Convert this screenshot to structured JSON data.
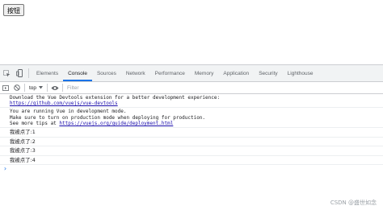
{
  "page": {
    "button_label": "按钮"
  },
  "devtools": {
    "tabs": [
      {
        "label": "Elements",
        "active": false
      },
      {
        "label": "Console",
        "active": true
      },
      {
        "label": "Sources",
        "active": false
      },
      {
        "label": "Network",
        "active": false
      },
      {
        "label": "Performance",
        "active": false
      },
      {
        "label": "Memory",
        "active": false
      },
      {
        "label": "Application",
        "active": false
      },
      {
        "label": "Security",
        "active": false
      },
      {
        "label": "Lighthouse",
        "active": false
      }
    ],
    "toolbar": {
      "context": "top",
      "filter_placeholder": "Filter"
    },
    "console": {
      "devtools_msg": {
        "line1": "Download the Vue Devtools extension for a better development experience:",
        "link": "https://github.com/vuejs/vue-devtools"
      },
      "dev_mode_msg": {
        "line1": "You are running Vue in development mode.",
        "line2": "Make sure to turn on production mode when deploying for production.",
        "line3_prefix": "See more tips at ",
        "link": "https://vuejs.org/guide/deployment.html"
      },
      "logs": [
        "我被点了:1",
        "我被点了:2",
        "我被点了:3",
        "我被点了:4"
      ],
      "prompt": "›"
    }
  },
  "watermark": "CSDN @盛世如念",
  "colors": {
    "accent": "#1a73e8",
    "link": "#1a0dab",
    "tabbar_bg": "#f1f3f4"
  },
  "icons": [
    "inspect-icon",
    "device-toggle-icon",
    "sidebar-toggle-icon",
    "clear-console-icon",
    "dropdown-arrow-icon",
    "eye-icon"
  ]
}
